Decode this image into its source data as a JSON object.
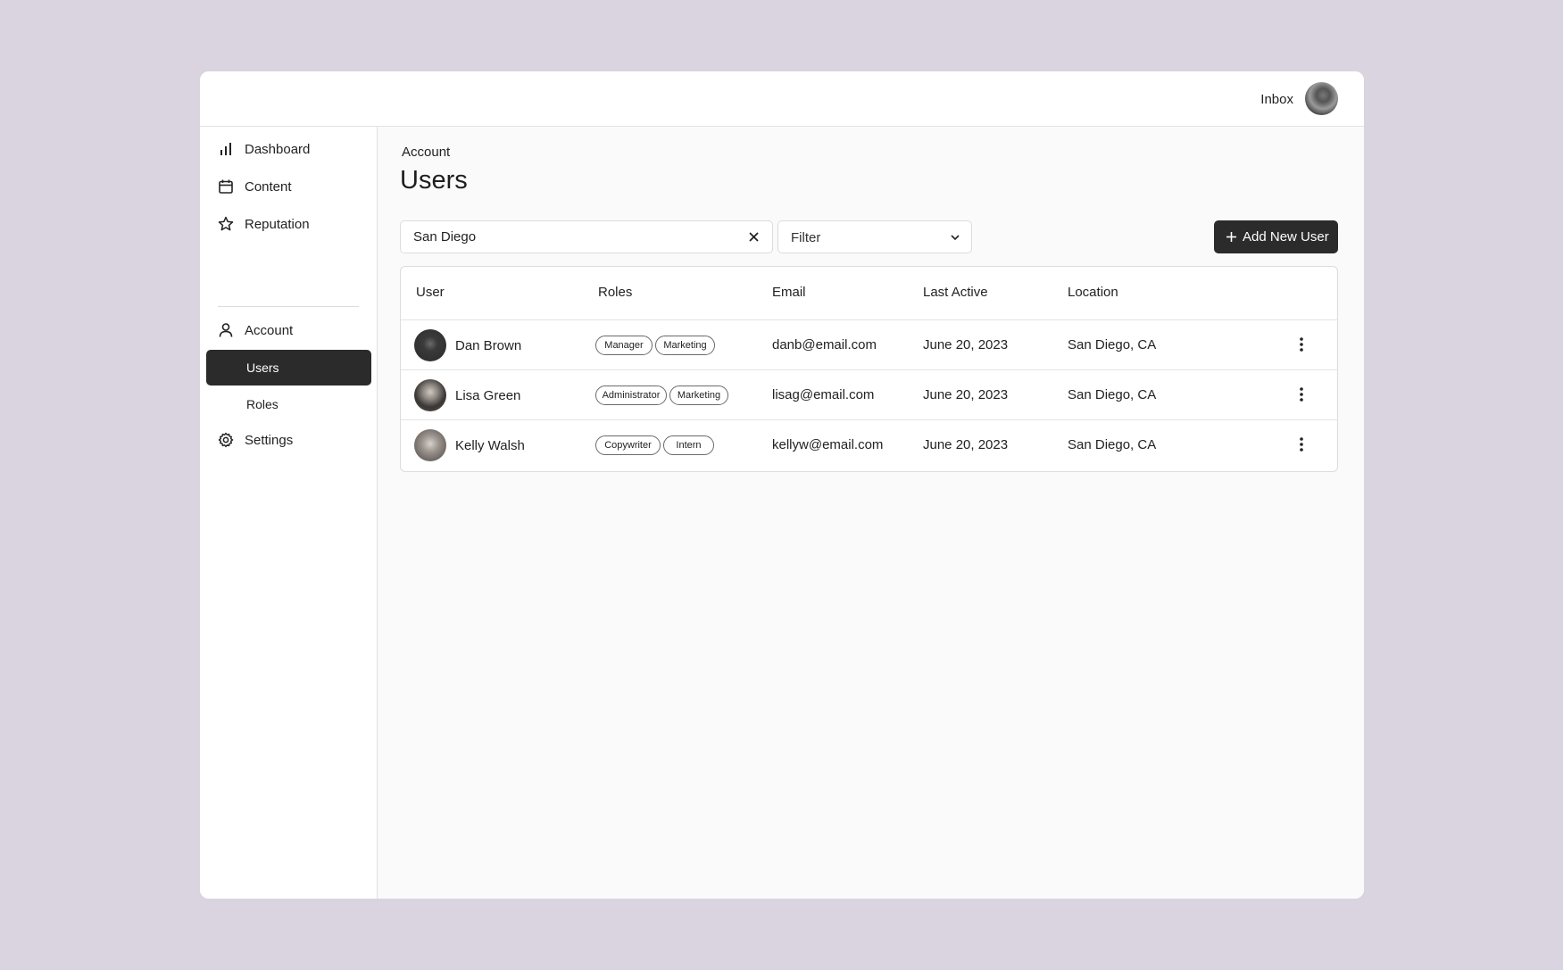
{
  "topbar": {
    "inbox_label": "Inbox",
    "avatar_icon": "user-avatar"
  },
  "sidebar": {
    "items": [
      {
        "label": "Dashboard",
        "icon": "bar-chart-icon"
      },
      {
        "label": "Content",
        "icon": "calendar-icon"
      },
      {
        "label": "Reputation",
        "icon": "star-icon"
      },
      {
        "label": "Account",
        "icon": "person-icon"
      },
      {
        "label": "Users",
        "active": true
      },
      {
        "label": "Roles"
      },
      {
        "label": "Settings",
        "icon": "gear-icon"
      }
    ]
  },
  "main": {
    "breadcrumb": "Account",
    "title": "Users",
    "search": {
      "value": "San Diego"
    },
    "filter": {
      "label": "Filter"
    },
    "add_button_label": "Add New User",
    "table": {
      "columns": [
        "User",
        "Roles",
        "Email",
        "Last Active",
        "Location"
      ],
      "rows": [
        {
          "name": "Dan Brown",
          "roles": [
            "Manager",
            "Marketing"
          ],
          "email": "danb@email.com",
          "last_active": "June 20, 2023",
          "location": "San Diego, CA"
        },
        {
          "name": "Lisa Green",
          "roles": [
            "Administrator",
            "Marketing"
          ],
          "email": "lisag@email.com",
          "last_active": "June 20, 2023",
          "location": "San Diego, CA"
        },
        {
          "name": "Kelly Walsh",
          "roles": [
            "Copywriter",
            "Intern"
          ],
          "email": "kellyw@email.com",
          "last_active": "June 20, 2023",
          "location": "San Diego, CA"
        }
      ]
    }
  },
  "colors": {
    "background": "#dad4e0",
    "accent_dark": "#2b2b2b",
    "surface": "#ffffff"
  }
}
